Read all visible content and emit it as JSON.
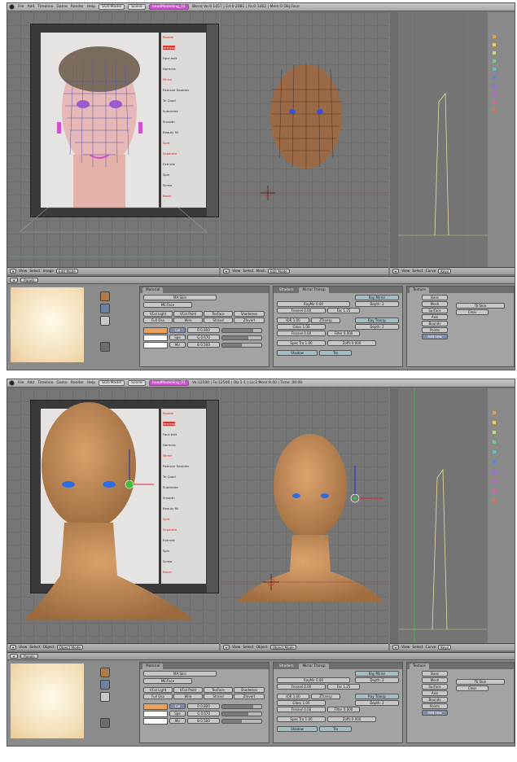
{
  "colors": {
    "menu_bg": "#b4b4b4",
    "viewport": "#767676",
    "props_bg": "#8b8b8b",
    "accent_pink": "#d050d0",
    "skin": "#b57a44",
    "wire_face": "#8a5f3e"
  },
  "menubar": {
    "items": [
      "File",
      "Add",
      "Timeline",
      "Game",
      "Render",
      "Help"
    ],
    "screen": "SCR-Model",
    "scene": "Scene",
    "scene_hl": "headModelling_01"
  },
  "shots": [
    {
      "info": "Blend Ve:9 1457 | Ed:0-2081 | Fa:0-1462 | Mem:0 Obj:Face",
      "image_list": [
        "Rouble",
        "Vertices",
        "Face edit",
        "Normals",
        "Mirror",
        "Remove Doubles",
        "Tri Quad",
        "Subdivide",
        "Smooth",
        "Beauty fill",
        "Split",
        "Separate",
        "Extrude",
        "Spin",
        "Screw",
        "Bevel"
      ],
      "header_left": {
        "view": "View",
        "select": "Select",
        "object": "Object",
        "mode": "Edit Mode",
        "image": "Image"
      },
      "header_mid": {
        "view": "View",
        "select": "Select",
        "mesh": "Mesh",
        "mode": "Edit Mode",
        "label": "(1) Face"
      },
      "header_right": {
        "view": "View",
        "select": "Select",
        "curve": "Curve",
        "key": "Keys"
      },
      "props": {
        "title1": "Material",
        "title2": "Mirror Transp",
        "title3": "Shaders",
        "mat_name": "MA:Skin",
        "me_name": "ME:Face",
        "buttons_row1": [
          "VCol Light",
          "VCol Paint",
          "TexFace",
          "Shadeless"
        ],
        "buttons_row2": [
          "Full Osa",
          "Wire",
          "Strand",
          "ZInvert"
        ],
        "rows": [
          {
            "name": "Col",
            "val": "R 0.800"
          },
          {
            "name": "Spe",
            "val": "G 0.670"
          },
          {
            "name": "Mir",
            "val": "B 0.500"
          }
        ],
        "mid": {
          "ray_mirror": "Ray Mirror",
          "depth": "Depth: 2",
          "rayref": "RayMir 0.00",
          "fresnel": "Fresnel 0.00",
          "fac": "Fac 1.25",
          "ray_transp": "Ray Transp",
          "ior": "IOR 1.00",
          "depth2": "Depth: 2",
          "fresnel2": "Fresnel 0.00",
          "gloss": "Gloss 1.00",
          "filter": "Filter 0.000",
          "spectra": "Spec Tra 1.00",
          "zoffset": "Zoffs 0.000",
          "fullosa": "ZTransp",
          "shadow": "Shadow",
          "tra": "Tra"
        },
        "right": {
          "items": [
            "Base",
            "Mesh",
            "Surface",
            "Axis",
            "Bounds",
            "Points",
            "Add new"
          ],
          "box": "TE:Skin",
          "tex": "Clear"
        }
      }
    },
    {
      "info": "Ve:12500 | Fa:12500 | Ob:1-1 | La:3 Mem:9.40 | Time: 00:00",
      "image_list": [
        "Rouble",
        "Vertices",
        "Face edit",
        "Normals",
        "Mirror",
        "Remove Doubles",
        "Tri Quad",
        "Subdivide",
        "Smooth",
        "Beauty fill",
        "Split",
        "Separate",
        "Extrude",
        "Spin",
        "Screw",
        "Bevel"
      ],
      "header_left": {
        "view": "View",
        "select": "Select",
        "object": "Object",
        "mode": "Object Mode",
        "image": "Image"
      },
      "header_mid": {
        "view": "View",
        "select": "Select",
        "mesh": "Object",
        "mode": "Object Mode",
        "label": "(1) Face"
      },
      "header_right": {
        "view": "View",
        "select": "Select",
        "curve": "Curve",
        "key": "Keys"
      },
      "props": {
        "title1": "Material",
        "title2": "Mirror Transp",
        "title3": "Shaders",
        "mat_name": "MA:Skin",
        "me_name": "ME:Face",
        "buttons_row1": [
          "VCol Light",
          "VCol Paint",
          "TexFace",
          "Shadeless"
        ],
        "buttons_row2": [
          "Full Osa",
          "Wire",
          "Strand",
          "ZInvert"
        ],
        "rows": [
          {
            "name": "Col",
            "val": "R 0.800"
          },
          {
            "name": "Spe",
            "val": "G 0.670"
          },
          {
            "name": "Mir",
            "val": "B 0.500"
          }
        ],
        "mid": {
          "ray_mirror": "Ray Mirror",
          "depth": "Depth: 2",
          "rayref": "RayMir 0.00",
          "fresnel": "Fresnel 0.00",
          "fac": "Fac 1.25",
          "ray_transp": "Ray Transp",
          "ior": "IOR 1.00",
          "depth2": "Depth: 2",
          "fresnel2": "Fresnel 0.00",
          "gloss": "Gloss 1.00",
          "filter": "Filter 0.000",
          "spectra": "Spec Tra 1.00",
          "zoffset": "Zoffs 0.000",
          "fullosa": "ZTransp",
          "shadow": "Shadow",
          "tra": "Tra"
        },
        "right": {
          "items": [
            "Base",
            "Mesh",
            "Surface",
            "Axis",
            "Bounds",
            "Points",
            "Add new"
          ],
          "box": "TE:Skin",
          "tex": "Clear"
        }
      }
    }
  ]
}
